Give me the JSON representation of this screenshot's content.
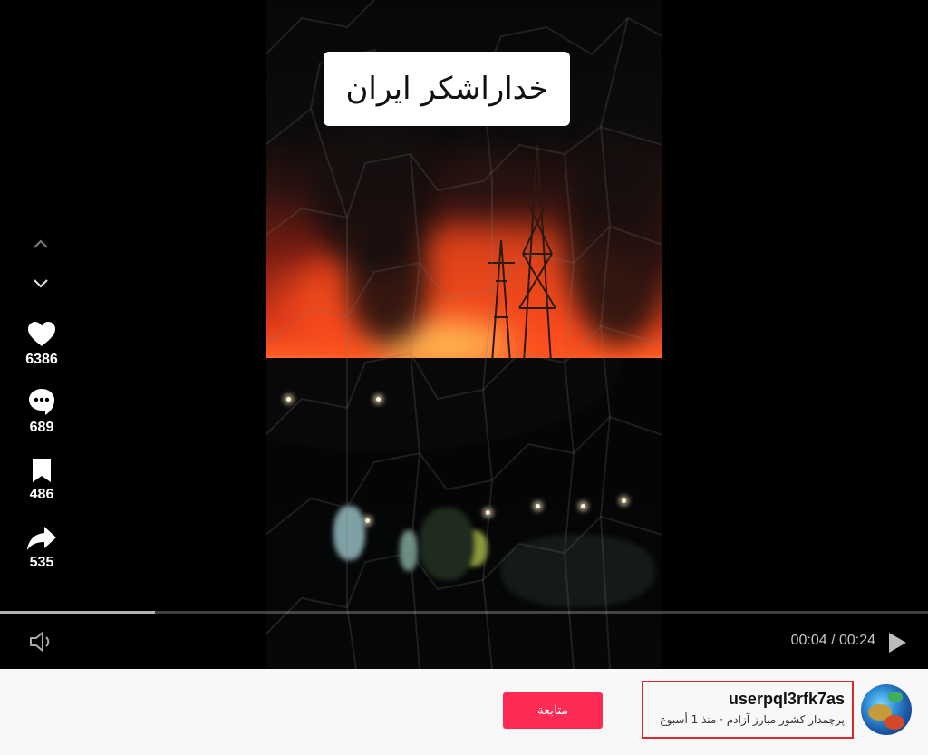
{
  "video": {
    "caption": "خداراشکر ایران",
    "progress": 0.167,
    "time_display": "00:04 / 00:24"
  },
  "actions": {
    "likes": "6386",
    "comments": "689",
    "saves": "486",
    "shares": "535"
  },
  "author": {
    "username": "userpql3rfk7as",
    "subline": "پرچمدار کشور مبارز آزادم · منذ 1 أسبوع",
    "follow_label": "متابعة"
  },
  "icons": {
    "previous": "chevron-up-icon",
    "next": "chevron-down-icon",
    "like": "heart-icon",
    "comment": "comment-bubble-icon",
    "save": "bookmark-icon",
    "share": "share-arrow-icon",
    "volume": "speaker-icon",
    "play": "play-icon"
  },
  "colors": {
    "follow_button": "#fe2c55",
    "highlight_border": "#e0262b"
  }
}
